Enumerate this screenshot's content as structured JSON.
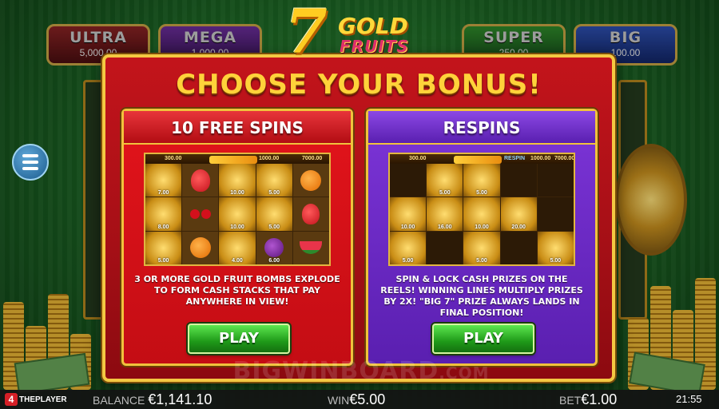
{
  "game": {
    "logo_seven": "7",
    "logo_gold": "GOLD",
    "logo_fruits": "FRUITS"
  },
  "jackpots": [
    {
      "name": "ULTRA",
      "value": "5,000.00"
    },
    {
      "name": "MEGA",
      "value": "1,000.00"
    },
    {
      "name": "SUPER",
      "value": "250.00"
    },
    {
      "name": "BIG",
      "value": "100.00"
    }
  ],
  "modal": {
    "title": "CHOOSE YOUR BONUS!",
    "free_spins": {
      "heading": "10 FREE SPINS",
      "preview_values": [
        "300.00",
        "1000.00",
        "7000.00"
      ],
      "description": "3 OR MORE GOLD FRUIT BOMBS EXPLODE TO FORM CASH STACKS THAT PAY ANYWHERE IN VIEW!",
      "play_label": "PLAY",
      "prizes": [
        "7.00",
        "10.00",
        "5.00",
        "8.00",
        "10.00",
        "5.00",
        "5.00",
        "4.00",
        "6.00"
      ]
    },
    "respins": {
      "heading": "RESPINS",
      "preview_values": [
        "300.00",
        "1000.00",
        "7000.00"
      ],
      "respin_tag": "RESPIN",
      "description": "SPIN & LOCK CASH PRIZES ON THE REELS! WINNING LINES MULTIPLY PRIZES BY 2X! \"BIG 7\" PRIZE ALWAYS LANDS IN FINAL POSITION!",
      "play_label": "PLAY",
      "prizes": [
        "5.00",
        "5.00",
        "10.00",
        "16.00",
        "10.00",
        "20.00",
        "5.00",
        "5.00",
        "5.00"
      ]
    }
  },
  "watermark": {
    "main": "BIGWINBOARD",
    "suffix": ".COM"
  },
  "bottombar": {
    "brand_badge": "4",
    "brand_text": "THEPLAYER",
    "balance_label": "BALANCE",
    "balance_value": "€1,141.10",
    "win_label": "WIN",
    "win_value": "€5.00",
    "bet_label": "BET",
    "bet_value": "€1.00",
    "clock": "21:55"
  },
  "colors": {
    "modal_red": "#c3141b",
    "gold_border": "#f4c842",
    "title_gold": "#ffd23a",
    "respin_purple": "#7d35d8",
    "play_green": "#1f9a19"
  },
  "icons": {
    "menu": "hamburger-menu-icon",
    "fruits": [
      "strawberry-icon",
      "orange-icon",
      "cherry-icon",
      "plum-icon",
      "watermelon-icon",
      "grapes-icon",
      "gold-bar-icon"
    ]
  }
}
